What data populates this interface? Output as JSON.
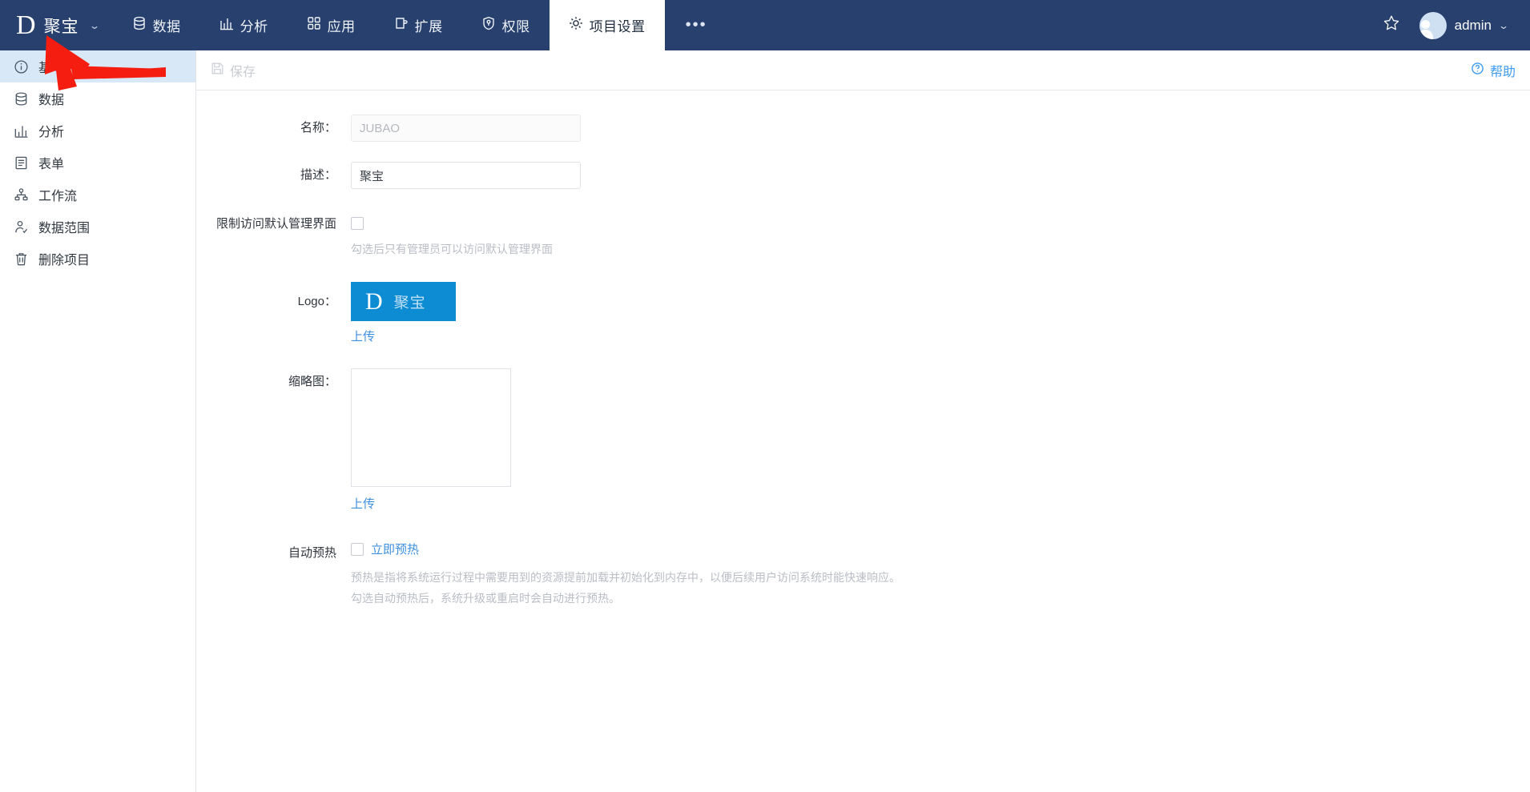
{
  "header": {
    "brand_mark": "D",
    "brand_name": "聚宝",
    "brand_caret": "⌄",
    "nav": [
      {
        "label": "数据",
        "icon": "database-icon"
      },
      {
        "label": "分析",
        "icon": "bar-chart-icon"
      },
      {
        "label": "应用",
        "icon": "grid-apps-icon"
      },
      {
        "label": "扩展",
        "icon": "extension-icon"
      },
      {
        "label": "权限",
        "icon": "shield-key-icon"
      },
      {
        "label": "项目设置",
        "icon": "gear-icon"
      }
    ],
    "active_nav": "项目设置",
    "more_dots": "•••",
    "user_name": "admin",
    "user_caret": "⌄"
  },
  "sidebar": {
    "items": [
      {
        "label": "基本",
        "icon": "info-circle-icon",
        "active": true
      },
      {
        "label": "数据",
        "icon": "database-icon",
        "active": false
      },
      {
        "label": "分析",
        "icon": "bar-chart-icon",
        "active": false
      },
      {
        "label": "表单",
        "icon": "form-icon",
        "active": false
      },
      {
        "label": "工作流",
        "icon": "workflow-icon",
        "active": false
      },
      {
        "label": "数据范围",
        "icon": "user-scope-icon",
        "active": false
      },
      {
        "label": "删除项目",
        "icon": "trash-icon",
        "active": false
      }
    ]
  },
  "toolbar": {
    "save_label": "保存",
    "help_label": "帮助"
  },
  "form": {
    "name": {
      "label": "名称：",
      "value": "JUBAO",
      "disabled": true
    },
    "description": {
      "label": "描述：",
      "value": "聚宝"
    },
    "restrict_access": {
      "label": "限制访问默认管理界面",
      "checked": false,
      "hint": "勾选后只有管理员可以访问默认管理界面"
    },
    "logo": {
      "label": "Logo：",
      "mark": "D",
      "text": "聚宝",
      "upload_label": "上传",
      "color": "#0d8bd3"
    },
    "thumbnail": {
      "label": "缩略图：",
      "upload_label": "上传"
    },
    "auto_preheat": {
      "label": "自动预热",
      "checkbox_label": "立即预热",
      "checked": false,
      "hint_line1": "预热是指将系统运行过程中需要用到的资源提前加载并初始化到内存中，以便后续用户访问系统时能快速响应。",
      "hint_line2": "勾选自动预热后，系统升级或重启时会自动进行预热。"
    }
  },
  "annotation": {
    "arrow_color": "#f41d10"
  },
  "colors": {
    "header_bg": "#27406e",
    "sidebar_active": "#d9e8f7",
    "link_blue": "#3d8fe0",
    "logo_blue": "#0d8bd3"
  }
}
